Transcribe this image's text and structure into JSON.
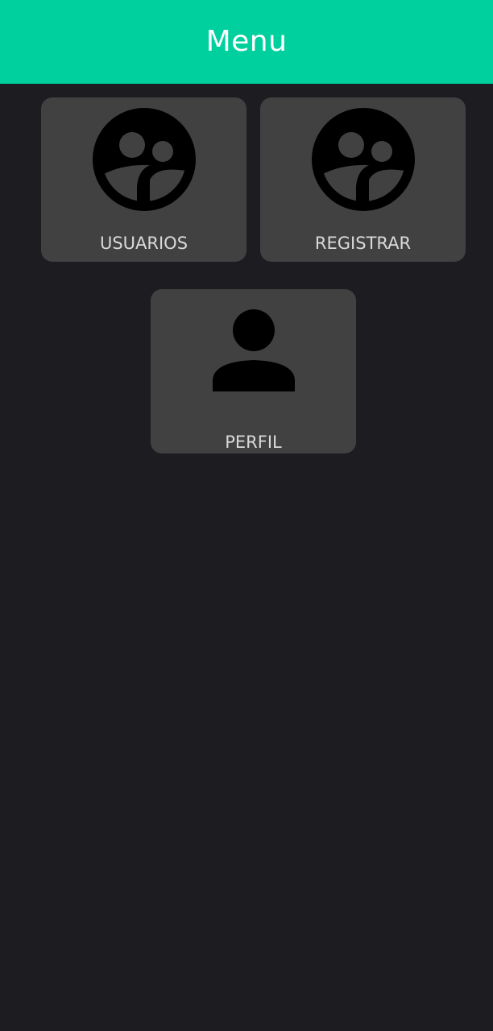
{
  "app_bar": {
    "title": "Menu",
    "color": "#00d09e"
  },
  "tiles": [
    {
      "label": "USUARIOS",
      "icon": "supervised-user-circle-icon"
    },
    {
      "label": "REGISTRAR",
      "icon": "supervised-user-circle-icon"
    },
    {
      "label": "PERFIL",
      "icon": "person-icon"
    }
  ],
  "colors": {
    "background": "#1d1c21",
    "tile": "#414141",
    "label": "#d9d9d9",
    "icon": "#000000"
  }
}
